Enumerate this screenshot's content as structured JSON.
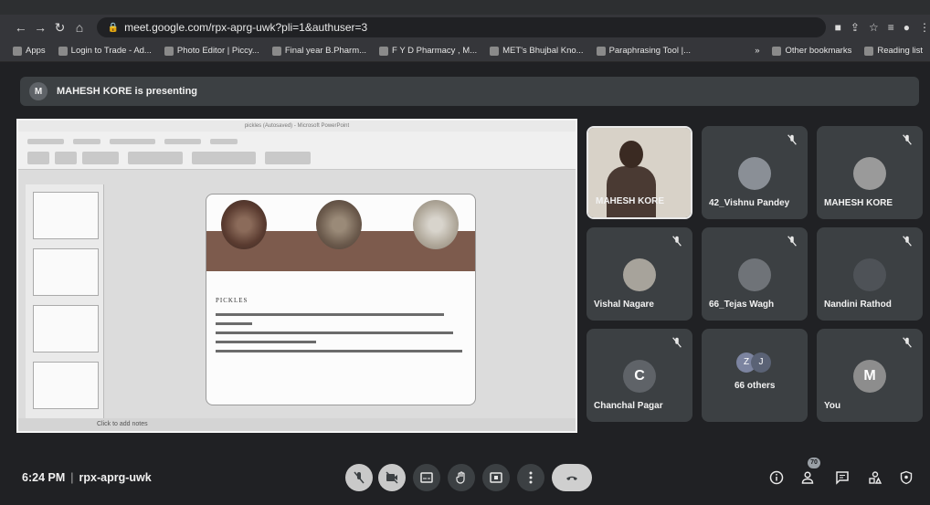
{
  "browser": {
    "url": "meet.google.com/rpx-aprg-uwk?pli=1&authuser=3",
    "bookmarks": [
      "Apps",
      "Login to Trade - Ad...",
      "Photo Editor | Piccy...",
      "Final year B.Pharm...",
      "F Y D Pharmacy , M...",
      "MET's Bhujbal Kno...",
      "Paraphrasing Tool |..."
    ],
    "bookmarks_right": [
      "Other bookmarks",
      "Reading list"
    ],
    "chevron": "»"
  },
  "meet": {
    "presenting_text": "MAHESH KORE is presenting",
    "presenter_initial": "M",
    "time": "6:24 PM",
    "meeting_code": "rpx-aprg-uwk",
    "participant_badge": "70"
  },
  "slide": {
    "window_title": "pickles (Autosaved) - Microsoft PowerPoint",
    "heading": "PICKLES",
    "status": "Click to add notes"
  },
  "tiles": [
    {
      "name": "MAHESH KORE",
      "type": "video"
    },
    {
      "name": "42_Vishnu Pandey",
      "type": "photo"
    },
    {
      "name": "MAHESH KORE",
      "type": "photo"
    },
    {
      "name": "Vishal Nagare",
      "type": "photo"
    },
    {
      "name": "66_Tejas Wagh",
      "type": "photo"
    },
    {
      "name": "Nandini Rathod",
      "type": "photo"
    },
    {
      "name": "Chanchal Pagar",
      "type": "letter",
      "initial": "C",
      "color": "#5f6368"
    },
    {
      "name": "66 others",
      "type": "others",
      "initials": [
        "Z",
        "J"
      ]
    },
    {
      "name": "You",
      "type": "letter",
      "initial": "M",
      "color": "#8d8d8d"
    }
  ]
}
